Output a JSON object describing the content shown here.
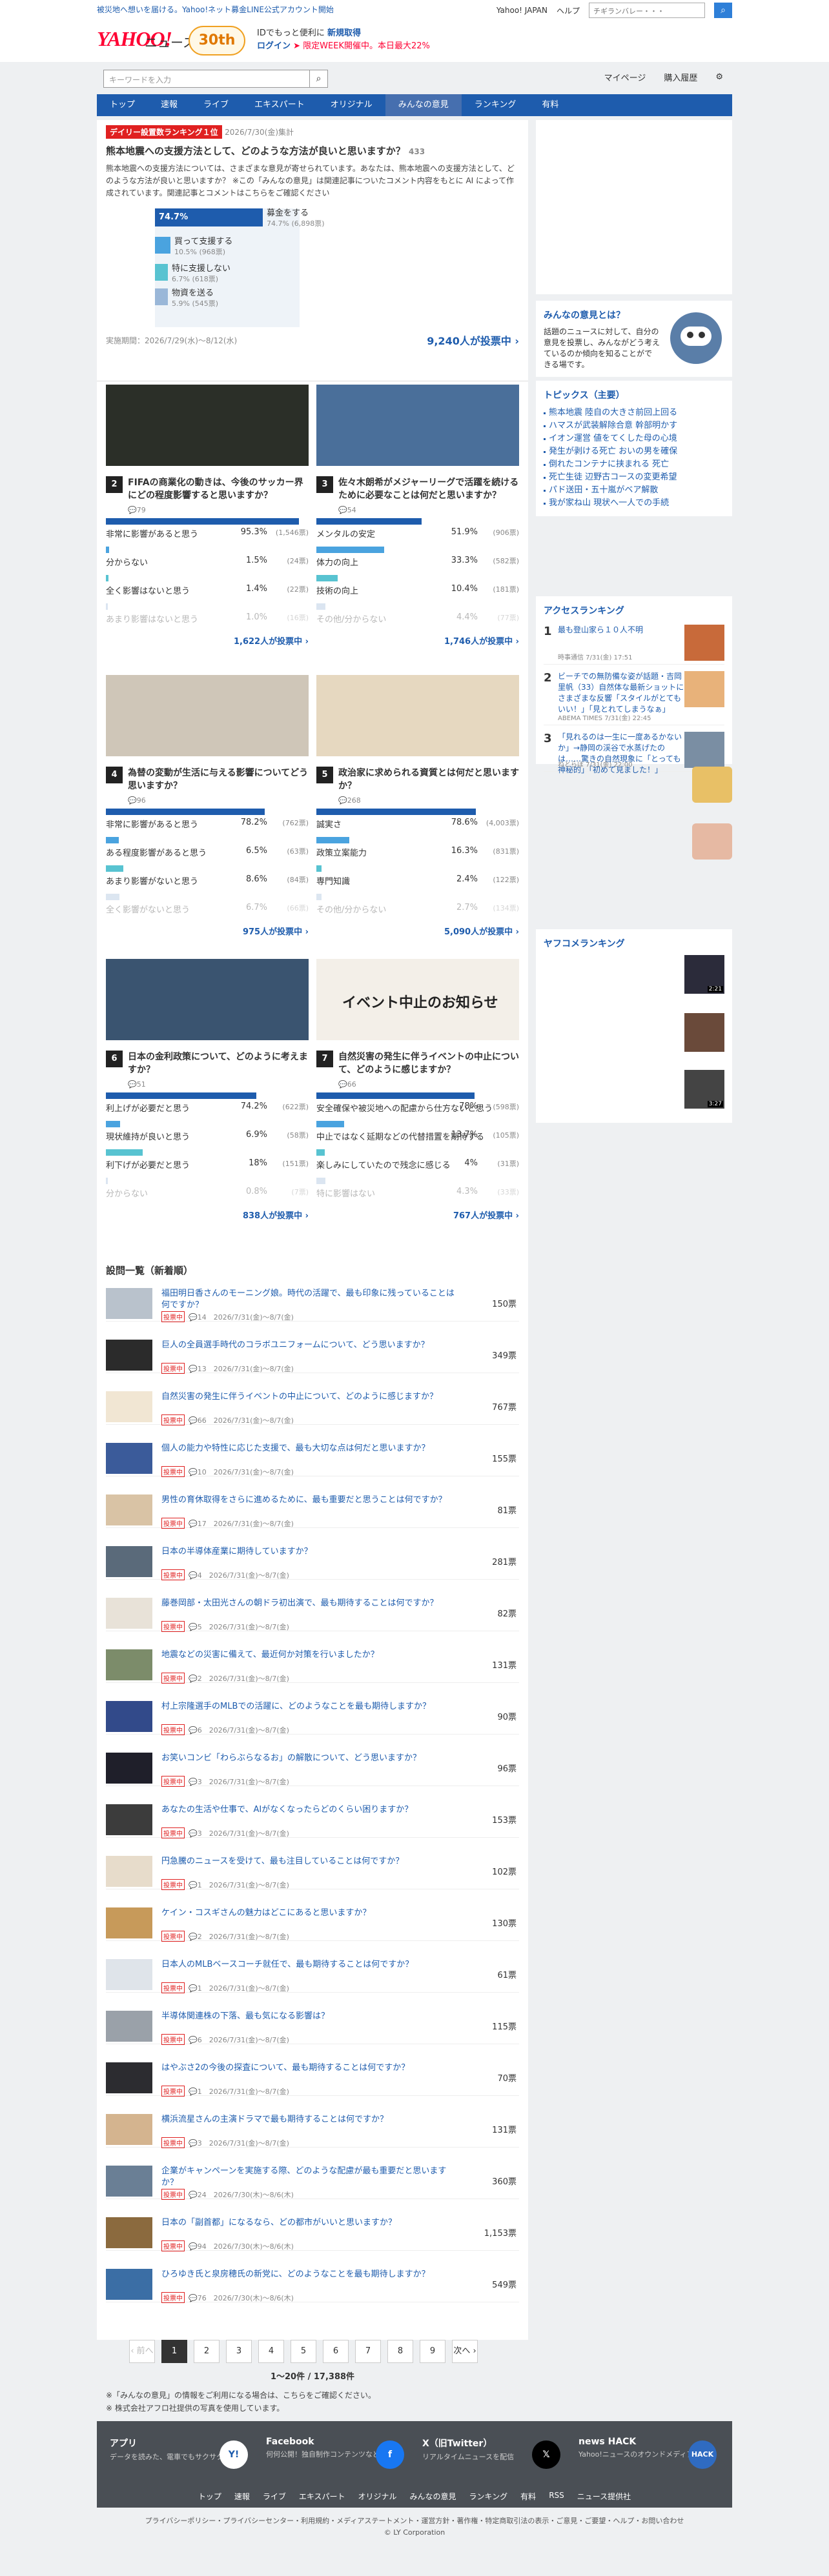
{
  "header": {
    "notice": "被災地へ想いを届ける。Yahoo!ネット募金LINE公式アカウント開始",
    "util_links": [
      "Yahoo! JAPAN",
      "ヘルプ"
    ],
    "search_placeholder": "ウェブ検索",
    "search_field_text": "チギランバレー・・・",
    "logo": "YAHOO!",
    "logo_sub": "ニュース",
    "logo_japan": "JAPAN",
    "badge": "30th",
    "id_promo_1": "IDでもっと便利に",
    "id_promo_1b": "新規取得",
    "id_promo_2": "ログイン",
    "id_promo_2b": "➤ 限定WEEK開催中。本日最大22%",
    "news_search_placeholder": "キーワードを入力",
    "mypage": "マイページ",
    "history": "購入履歴"
  },
  "nav": {
    "items": [
      "トップ",
      "速報",
      "ライブ",
      "エキスパート",
      "オリジナル",
      "みんなの意見",
      "ランキング",
      "有料"
    ],
    "active": 5
  },
  "feature": {
    "badge": "デイリー設置数ランキング１位",
    "date": "2026/7/30(金)集計",
    "question": "熊本地震への支援方法として、どのような方法が良いと思いますか？",
    "comments": "433",
    "desc": "熊本地震への支援方法については、さまざまな意見が寄せられています。あなたは、熊本地震への支援方法として、どのような方法が良いと思いますか？ ※この「みんなの意見」は関連記事についたコメント内容をもとに AI によって作成されています。関連記事とコメントはこちらをご確認ください",
    "options": [
      {
        "label": "募金をする",
        "pct": "74.7%",
        "count": "(6,898票)",
        "value": 74.7,
        "color": "#1e5cad"
      },
      {
        "label": "買って支援する",
        "pct": "10.5%",
        "count": "(968票)",
        "value": 10.5,
        "color": "#4aa3df"
      },
      {
        "label": "特に支援しない",
        "pct": "6.7%",
        "count": "(618票)",
        "value": 6.7,
        "color": "#58c3d1"
      },
      {
        "label": "物資を送る",
        "pct": "5.9%",
        "count": "(545票)",
        "value": 5.9,
        "color": "#9ab7d8"
      }
    ],
    "period": "実施期間：2026/7/29(水)〜8/12(水)",
    "total": "9,240人が投票中 ›"
  },
  "grid": [
    {
      "num": "2",
      "q": "FIFAの商業化の動きは、今後のサッカー界にどの程度影響すると思いますか？",
      "comments": "79",
      "options": [
        {
          "label": "非常に影響があると思う",
          "pct": "95.3%",
          "count": "(1,546票)",
          "value": 95.3
        },
        {
          "label": "分からない",
          "pct": "1.5%",
          "count": "(24票)",
          "value": 1.5
        },
        {
          "label": "全く影響はないと思う",
          "pct": "1.4%",
          "count": "(22票)",
          "value": 1.4
        },
        {
          "label": "あまり影響はないと思う",
          "pct": "1.0%",
          "count": "(16票)",
          "value": 1.0
        }
      ],
      "total": "1,622人が投票中 ›"
    },
    {
      "num": "3",
      "q": "佐々木朗希がメジャーリーグで活躍を続けるために必要なことは何だと思いますか？",
      "comments": "54",
      "options": [
        {
          "label": "メンタルの安定",
          "pct": "51.9%",
          "count": "(906票)",
          "value": 51.9
        },
        {
          "label": "体力の向上",
          "pct": "33.3%",
          "count": "(582票)",
          "value": 33.3
        },
        {
          "label": "技術の向上",
          "pct": "10.4%",
          "count": "(181票)",
          "value": 10.4
        },
        {
          "label": "その他/分からない",
          "pct": "4.4%",
          "count": "(77票)",
          "value": 4.4
        }
      ],
      "total": "1,746人が投票中 ›"
    },
    {
      "num": "4",
      "q": "為替の変動が生活に与える影響についてどう思いますか？",
      "comments": "96",
      "options": [
        {
          "label": "非常に影響があると思う",
          "pct": "78.2%",
          "count": "(762票)",
          "value": 78.2
        },
        {
          "label": "ある程度影響があると思う",
          "pct": "6.5%",
          "count": "(63票)",
          "value": 6.5
        },
        {
          "label": "あまり影響がないと思う",
          "pct": "8.6%",
          "count": "(84票)",
          "value": 8.6
        },
        {
          "label": "全く影響がないと思う",
          "pct": "6.7%",
          "count": "(66票)",
          "value": 6.7
        }
      ],
      "total": "975人が投票中 ›"
    },
    {
      "num": "5",
      "q": "政治家に求められる資質とは何だと思いますか？",
      "comments": "268",
      "options": [
        {
          "label": "誠実さ",
          "pct": "78.6%",
          "count": "(4,003票)",
          "value": 78.6
        },
        {
          "label": "政策立案能力",
          "pct": "16.3%",
          "count": "(831票)",
          "value": 16.3
        },
        {
          "label": "専門知識",
          "pct": "2.4%",
          "count": "(122票)",
          "value": 2.4
        },
        {
          "label": "その他/分からない",
          "pct": "2.7%",
          "count": "(134票)",
          "value": 2.7
        }
      ],
      "total": "5,090人が投票中 ›"
    },
    {
      "num": "6",
      "q": "日本の金利政策について、どのように考えますか？",
      "comments": "51",
      "options": [
        {
          "label": "利上げが必要だと思う",
          "pct": "74.2%",
          "count": "(622票)",
          "value": 74.2
        },
        {
          "label": "現状維持が良いと思う",
          "pct": "6.9%",
          "count": "(58票)",
          "value": 6.9
        },
        {
          "label": "利下げが必要だと思う",
          "pct": "18%",
          "count": "(151票)",
          "value": 18
        },
        {
          "label": "分からない",
          "pct": "0.8%",
          "count": "(7票)",
          "value": 0.8
        }
      ],
      "total": "838人が投票中 ›"
    },
    {
      "num": "7",
      "q": "自然災害の発生に伴うイベントの中止について、どのように感じますか？",
      "comments": "66",
      "img_text": "イベント中止のお知らせ",
      "options": [
        {
          "label": "安全確保や被災地への配慮から仕方ないと思う",
          "pct": "78%",
          "count": "(598票)",
          "value": 78
        },
        {
          "label": "中止ではなく延期などの代替措置を期待する",
          "pct": "13.7%",
          "count": "(105票)",
          "value": 13.7
        },
        {
          "label": "楽しみにしていたので残念に感じる",
          "pct": "4%",
          "count": "(31票)",
          "value": 4
        },
        {
          "label": "特に影響はない",
          "pct": "4.3%",
          "count": "(33票)",
          "value": 4.3
        }
      ],
      "total": "767人が投票中 ›"
    }
  ],
  "list": {
    "heading": "設問一覧（新着順）",
    "tag": "投票中",
    "rows": [
      {
        "t": "福田明日香さんのモーニング娘。時代の活躍で、最も印象に残っていることは何ですか？",
        "m": "14　2026/7/31(金)〜8/7(金)",
        "v": "150票"
      },
      {
        "t": "巨人の全員選手時代のコラボユニフォームについて、どう思いますか？",
        "m": "13　2026/7/31(金)〜8/7(金)",
        "v": "349票"
      },
      {
        "t": "自然災害の発生に伴うイベントの中止について、どのように感じますか？",
        "m": "66　2026/7/31(金)〜8/7(金)",
        "v": "767票"
      },
      {
        "t": "個人の能力や特性に応じた支援で、最も大切な点は何だと思いますか？",
        "m": "10　2026/7/31(金)〜8/7(金)",
        "v": "155票"
      },
      {
        "t": "男性の育休取得をさらに進めるために、最も重要だと思うことは何ですか？",
        "m": "17　2026/7/31(金)〜8/7(金)",
        "v": "81票"
      },
      {
        "t": "日本の半導体産業に期待していますか？",
        "m": "4　2026/7/31(金)〜8/7(金)",
        "v": "281票"
      },
      {
        "t": "藤巻岡部・太田光さんの朝ドラ初出演で、最も期待することは何ですか？",
        "m": "5　2026/7/31(金)〜8/7(金)",
        "v": "82票"
      },
      {
        "t": "地震などの災害に備えて、最近何か対策を行いましたか？",
        "m": "2　2026/7/31(金)〜8/7(金)",
        "v": "131票"
      },
      {
        "t": "村上宗隆選手のMLBでの活躍に、どのようなことを最も期待しますか？",
        "m": "6　2026/7/31(金)〜8/7(金)",
        "v": "90票"
      },
      {
        "t": "お笑いコンビ「わらぶらなるお」の解散について、どう思いますか？",
        "m": "3　2026/7/31(金)〜8/7(金)",
        "v": "96票"
      },
      {
        "t": "あなたの生活や仕事で、AIがなくなったらどのくらい困りますか？",
        "m": "3　2026/7/31(金)〜8/7(金)",
        "v": "153票"
      },
      {
        "t": "円急騰のニュースを受けて、最も注目していることは何ですか？",
        "m": "1　2026/7/31(金)〜8/7(金)",
        "v": "102票"
      },
      {
        "t": "ケイン・コスギさんの魅力はどこにあると思いますか？",
        "m": "2　2026/7/31(金)〜8/7(金)",
        "v": "130票"
      },
      {
        "t": "日本人のMLBベースコーチ就任で、最も期待することは何ですか？",
        "m": "1　2026/7/31(金)〜8/7(金)",
        "v": "61票"
      },
      {
        "t": "半導体関連株の下落、最も気になる影響は？",
        "m": "6　2026/7/31(金)〜8/7(金)",
        "v": "115票"
      },
      {
        "t": "はやぶさ2の今後の探査について、最も期待することは何ですか？",
        "m": "1　2026/7/31(金)〜8/7(金)",
        "v": "70票"
      },
      {
        "t": "横浜流星さんの主演ドラマで最も期待することは何ですか？",
        "m": "3　2026/7/31(金)〜8/7(金)",
        "v": "131票"
      },
      {
        "t": "企業がキャンペーンを実施する際、どのような配慮が最も重要だと思いますか？",
        "m": "24　2026/7/30(木)〜8/6(木)",
        "v": "360票"
      },
      {
        "t": "日本の「副首都」になるなら、どの都市がいいと思いますか？",
        "m": "94　2026/7/30(木)〜8/6(木)",
        "v": "1,153票"
      },
      {
        "t": "ひろゆき氏と泉房穂氏の新党に、どのようなことを最も期待しますか？",
        "m": "76　2026/7/30(木)〜8/6(木)",
        "v": "549票"
      }
    ],
    "thumb_colors": [
      "#b9c2cc",
      "#2b2b2b",
      "#f1e6d3",
      "#3b5b9a",
      "#d9c3a5",
      "#5a6a7a",
      "#e8e2d8",
      "#7c8c6a",
      "#324a8a",
      "#1f1f2a",
      "#3c3c3c",
      "#e7dccb",
      "#c79a5a",
      "#dfe4ea",
      "#9aa1a9",
      "#2c2c30",
      "#d4b48f",
      "#6a7f95",
      "#8b6a3e",
      "#3b6ea5"
    ]
  },
  "pagination": {
    "prev": "‹ 前へ",
    "pages": [
      "1",
      "2",
      "3",
      "4",
      "5",
      "6",
      "7",
      "8",
      "9"
    ],
    "next": "次へ ›",
    "summary": "1〜20件 / 17,388件"
  },
  "notes": [
    "※「みんなの意見」の情報をご利用になる場合は、こちらをご確認ください。",
    "※ 株式会社アフロ社提供の写真を使用しています。"
  ],
  "sidebar": {
    "about_title": "みんなの意見とは？",
    "about_text": "話題のニュースに対して、自分の意見を投票し、みんながどう考えているのか傾向を知ることができる場です。",
    "topics_title": "トピックス（主要）",
    "topics": [
      "熊本地震 陸自の大きさ前回上回る",
      "ハマスが武装解除合意 幹部明かす",
      "イオン運営 値をてくした母の心境",
      "発生が剥ける死亡 おいの男を確保",
      "倒れたコンテナに挟まれる 死亡",
      "死亡生徒 辺野古コースの変更希望",
      "パド送田・五十嵐がベア解散",
      "我が家ね山 現状へ一人での手続"
    ],
    "access_title": "アクセスランキング",
    "access": [
      {
        "n": "1",
        "t": "最も登山家ら１０人不明",
        "s": "時事通信 7/31(金) 17:51"
      },
      {
        "n": "2",
        "t": "ビーチでの無防備な姿が話題・吉岡里帆（33）自然体な最新ショットにさまざまな反響「スタイルがとてもいい！」「見とれてしまうなぁ」",
        "s": "ABEMA TIMES 7/31(金) 22:45"
      },
      {
        "n": "3",
        "t": "「見れるのは一生に一度あるかないか」→静岡の渓谷で水蒸げたのは……驚きの自然現象に「とっても神秘的」「初めて見ました！」",
        "s": "ねとらぼ 7/31(金) 22:00"
      }
    ],
    "yafuko_title": "ヤフコメランキング",
    "video_durations": [
      "2:21",
      "3:27"
    ]
  },
  "footer": {
    "apps": [
      {
        "name": "アプリ",
        "desc": "データを読みた、電車でもサクサク"
      },
      {
        "name": "Facebook",
        "desc": "何何公開！独自制作コンテンツなども配信"
      },
      {
        "name": "X（旧Twitter）",
        "desc": "リアルタイムニュースを配信"
      },
      {
        "name": "news HACK",
        "desc": "Yahoo!ニュースのオウンドメディア"
      }
    ],
    "nav": [
      "トップ",
      "速報",
      "ライブ",
      "エキスパート",
      "オリジナル",
      "みんなの意見",
      "ランキング",
      "有料",
      "RSS",
      "ニュース提供社"
    ],
    "legal_links": "プライバシーポリシー・プライバシーセンター・利用規約・メディアステートメント・運営方針・著作権・特定商取引法の表示・ご意見・ご要望・ヘルプ・お問い合わせ",
    "copyright": "© LY Corporation"
  },
  "colors": {
    "accent": "#1e5cad",
    "brand_red": "#ff0033",
    "nav_bg": "#1e5cad"
  }
}
